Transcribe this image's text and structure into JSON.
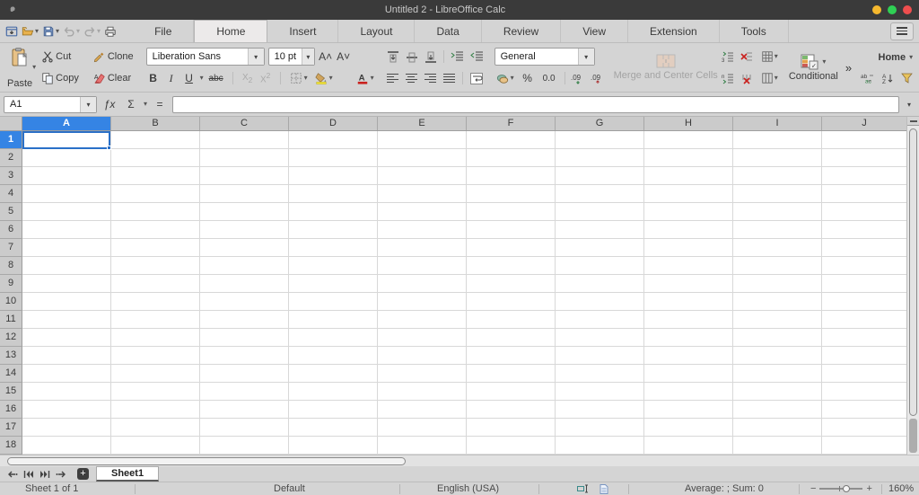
{
  "window": {
    "title": "Untitled 2 - LibreOffice Calc"
  },
  "tabs": {
    "items": [
      "File",
      "Home",
      "Insert",
      "Layout",
      "Data",
      "Review",
      "View",
      "Extension",
      "Tools"
    ],
    "active": "Home"
  },
  "quickbar": {
    "icons": [
      "menubar-toggle",
      "open",
      "save",
      "undo",
      "redo",
      "print"
    ]
  },
  "toolbar": {
    "paste": "Paste",
    "cut": "Cut",
    "copy": "Copy",
    "clone": "Clone",
    "clear": "Clear",
    "font_name": "Liberation Sans",
    "font_size": "10 pt",
    "bold": "B",
    "italic": "I",
    "underline": "U",
    "strikethrough": "abc",
    "percent": "%",
    "thousands": "0.0",
    "number_format": "General",
    "merge": "Merge and Center Cells",
    "conditional": "Conditional",
    "more": "»",
    "home_menu": "Home"
  },
  "formula_bar": {
    "cell_reference": "A1",
    "fx": "ƒx",
    "sum": "Σ",
    "equals": "=",
    "formula_value": ""
  },
  "grid": {
    "columns": [
      "A",
      "B",
      "C",
      "D",
      "E",
      "F",
      "G",
      "H",
      "I",
      "J"
    ],
    "rows": [
      "1",
      "2",
      "3",
      "4",
      "5",
      "6",
      "7",
      "8",
      "9",
      "10",
      "11",
      "12",
      "13",
      "14",
      "15",
      "16",
      "17",
      "18"
    ],
    "selected_cell": "A1",
    "selected_column": "A",
    "selected_row": "1"
  },
  "sheet_bar": {
    "tabs": [
      "Sheet1"
    ],
    "active": "Sheet1"
  },
  "status_bar": {
    "sheet_info": "Sheet 1 of 1",
    "page_style": "Default",
    "language": "English (USA)",
    "stats": "Average: ; Sum: 0",
    "zoom": "160%"
  },
  "colors": {
    "accent_blue": "#3584e4",
    "selection_border": "#2a70c8",
    "titlebar": "#3a3a3a",
    "panel_gray": "#d4d4d4",
    "delete_red": "#c9211e",
    "min_yellow": "#f5b82e",
    "max_green": "#2fd054",
    "close_red": "#ef4e4e"
  }
}
